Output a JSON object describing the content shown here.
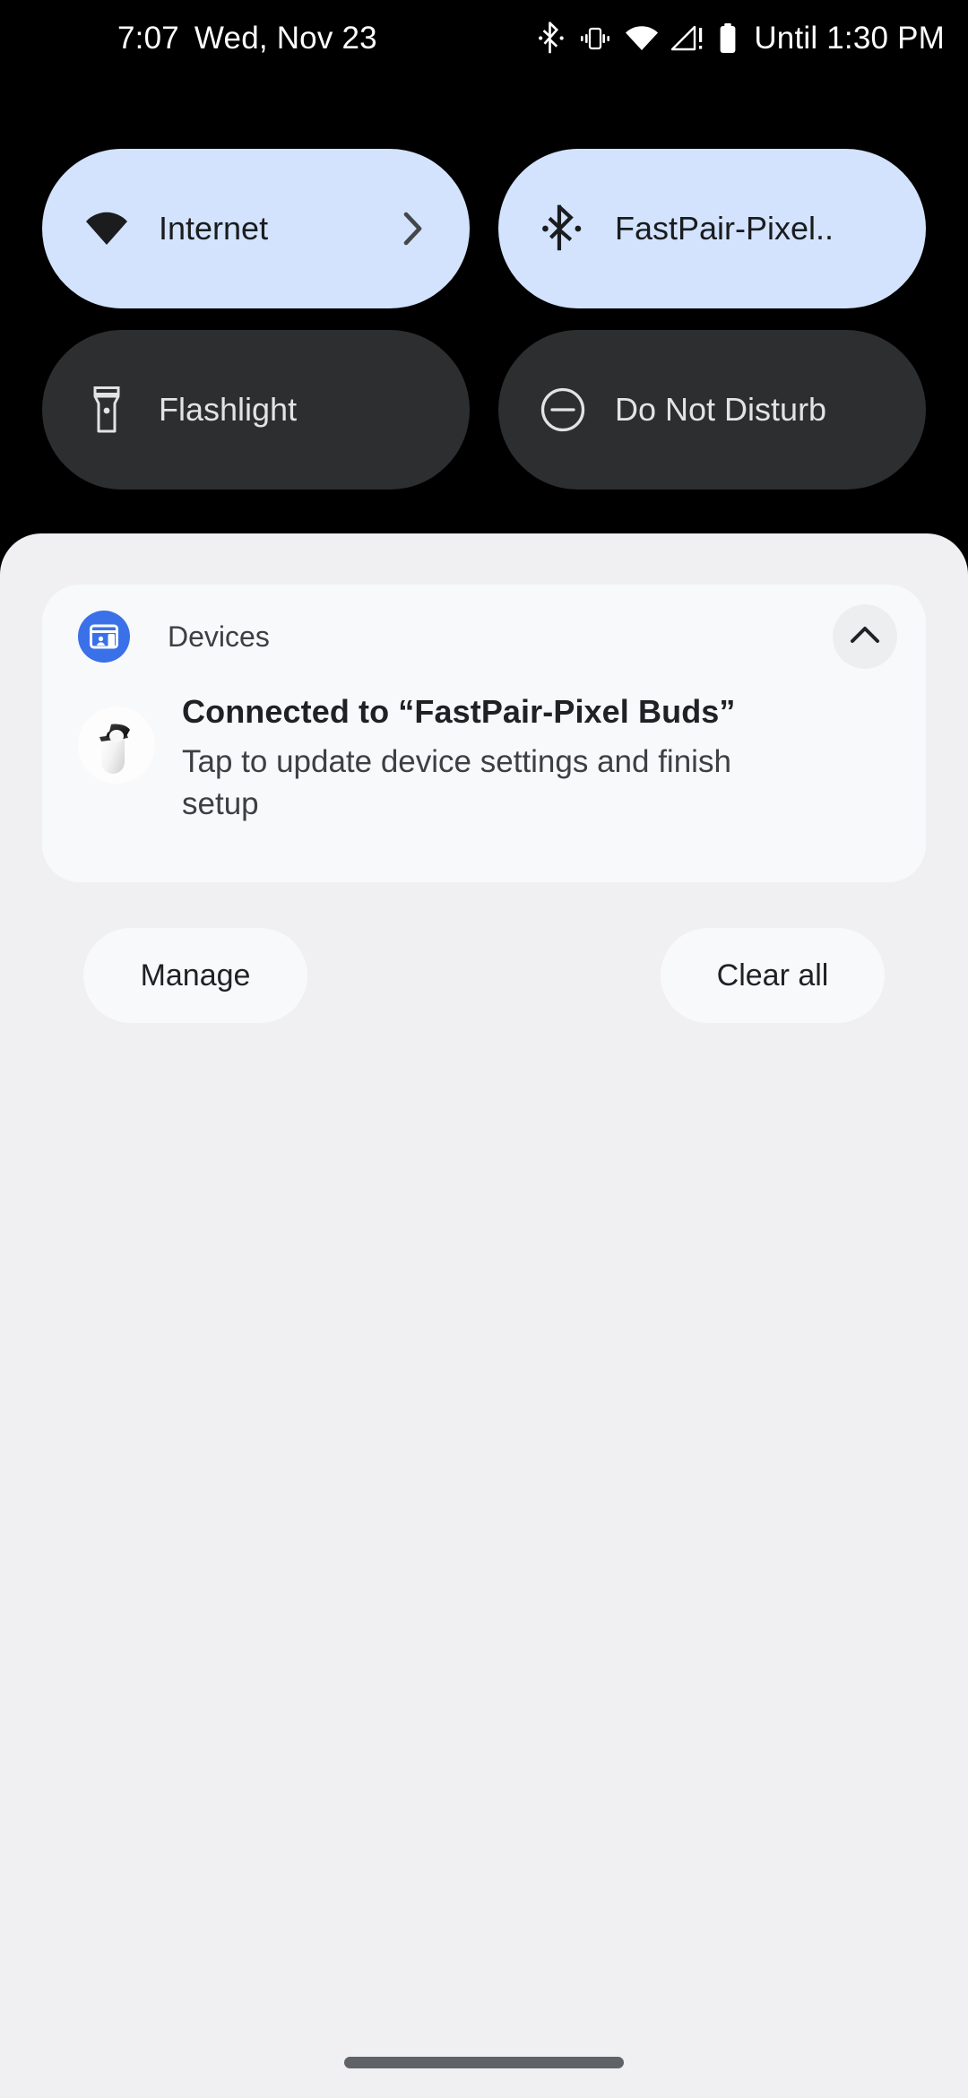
{
  "statusbar": {
    "time": "7:07",
    "date": "Wed, Nov 23",
    "battery_estimate": "Until 1:30 PM",
    "icons": [
      "bluetooth-icon",
      "vibrate-icon",
      "wifi-icon",
      "no-signal-icon",
      "battery-icon"
    ]
  },
  "quick_settings": {
    "tiles": [
      {
        "label": "Internet",
        "icon": "wifi-icon",
        "state": "on",
        "has_chevron": true
      },
      {
        "label": "FastPair-Pixel..",
        "icon": "bluetooth-icon",
        "state": "on",
        "has_chevron": false
      },
      {
        "label": "Flashlight",
        "icon": "flashlight-icon",
        "state": "off",
        "has_chevron": false
      },
      {
        "label": "Do Not Disturb",
        "icon": "do-not-disturb-icon",
        "state": "off",
        "has_chevron": false
      }
    ],
    "colors": {
      "tile_on_bg": "#d3e3fd",
      "tile_off_bg": "#2c2e30",
      "background": "#000000"
    }
  },
  "shade": {
    "background": "#f0f0f3",
    "notification": {
      "app_name": "Devices",
      "app_icon": "devices-icon",
      "app_icon_color": "#3b71e8",
      "collapse_icon": "chevron-up-icon",
      "thumbnail": "pixel-buds-case-image",
      "title": "Connected to “FastPair-Pixel Buds”",
      "body": "Tap to update device settings and finish setup"
    },
    "footer": {
      "manage_label": "Manage",
      "clear_all_label": "Clear all"
    }
  }
}
